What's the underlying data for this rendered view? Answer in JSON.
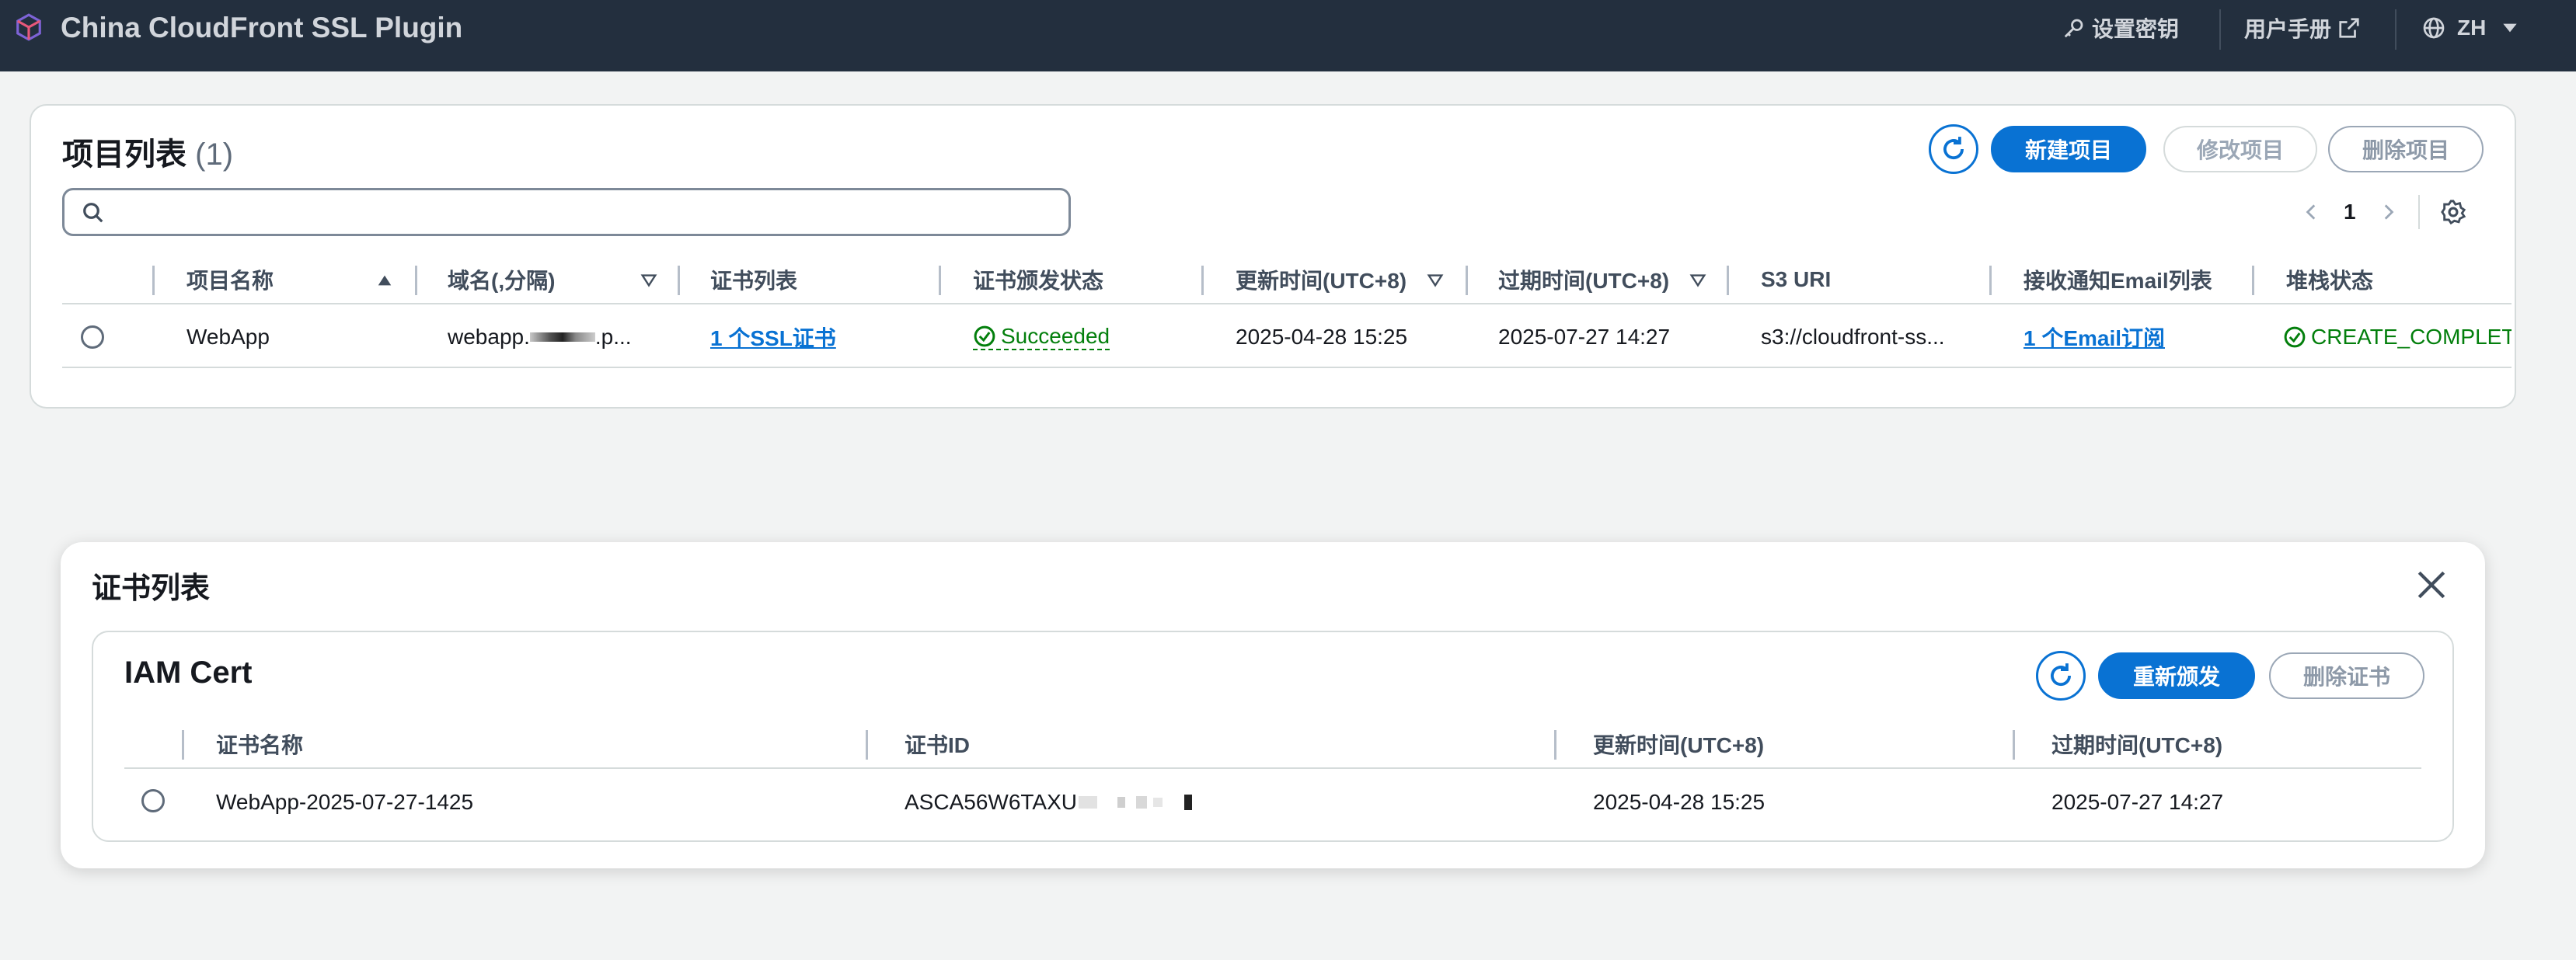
{
  "header": {
    "app_title": "China CloudFront SSL Plugin",
    "logo_icon": "cube-icon",
    "set_key": "设置密钥",
    "user_manual": "用户手册",
    "language": "ZH"
  },
  "projects": {
    "title": "项目列表",
    "count": "(1)",
    "buttons": {
      "new": "新建项目",
      "edit": "修改项目",
      "delete": "删除项目"
    },
    "search": {
      "value": "",
      "placeholder": ""
    },
    "pagination": {
      "page": "1"
    },
    "columns": [
      "项目名称",
      "域名(,分隔)",
      "证书列表",
      "证书颁发状态",
      "更新时间(UTC+8)",
      "过期时间(UTC+8)",
      "S3 URI",
      "接收通知Email列表",
      "堆栈状态"
    ],
    "rows": [
      {
        "name": "WebApp",
        "domain_prefix": "webapp.",
        "domain_suffix": ".p...",
        "certs": "1 个SSL证书",
        "status": "Succeeded",
        "updated": "2025-04-28 15:25",
        "expires": "2025-07-27 14:27",
        "s3_uri": "s3://cloudfront-ss...",
        "emails": "1 个Email订阅",
        "stack_status": "CREATE_COMPLETE"
      }
    ]
  },
  "modal": {
    "title": "证书列表",
    "card_title": "IAM Cert",
    "buttons": {
      "reissue": "重新颁发",
      "delete": "删除证书"
    },
    "columns": [
      "证书名称",
      "证书ID",
      "更新时间(UTC+8)",
      "过期时间(UTC+8)"
    ],
    "rows": [
      {
        "name": "WebApp-2025-07-27-1425",
        "id_visible": "ASCA56W6TAXU",
        "updated": "2025-04-28 15:25",
        "expires": "2025-07-27 14:27"
      }
    ]
  },
  "colors": {
    "nav_bg": "#232f3e",
    "primary": "#0972d3",
    "success": "#037f0c",
    "page_bg": "#f2f3f3"
  }
}
